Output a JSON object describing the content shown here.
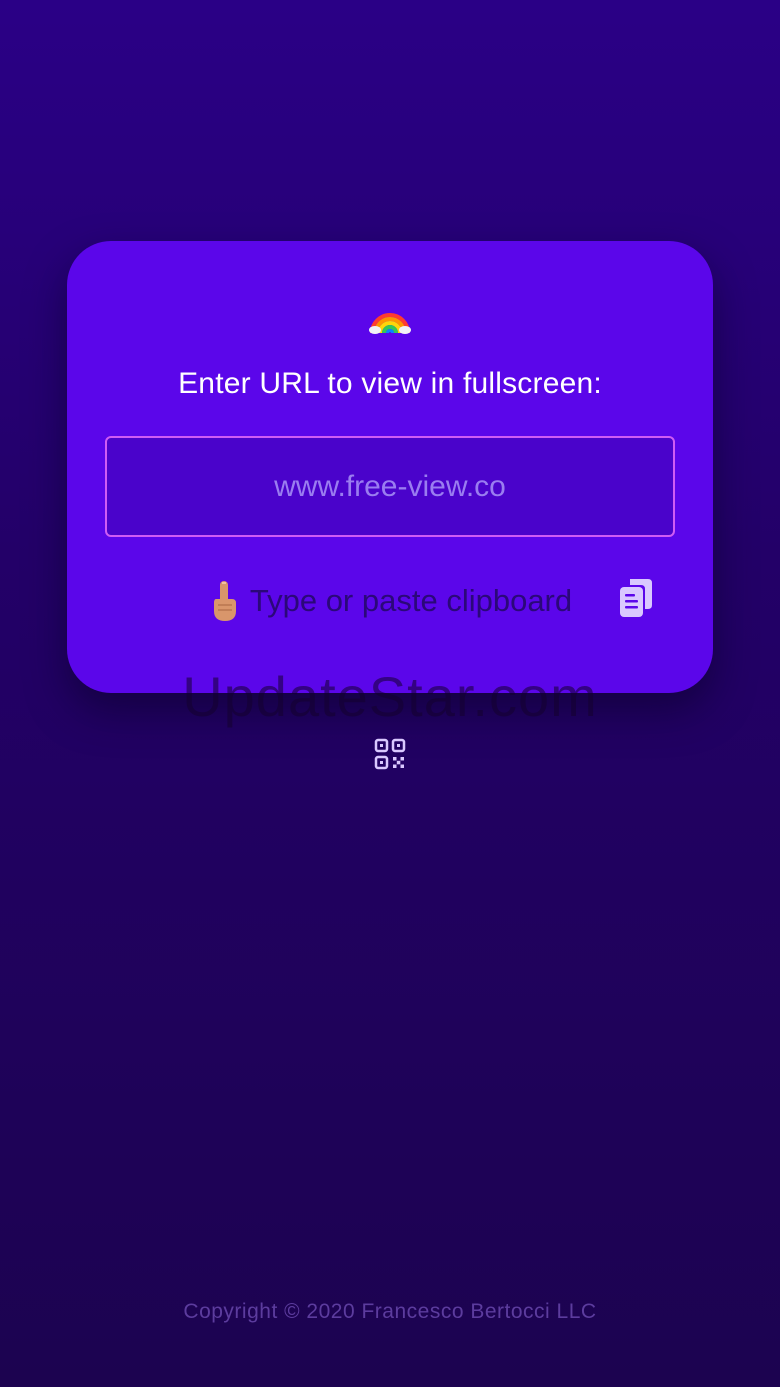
{
  "card": {
    "rainbow_icon": "rainbow-emoji",
    "title": "Enter URL to view in fullscreen:",
    "url_input": {
      "placeholder": "www.free-view.co",
      "value": ""
    },
    "paste_hint": {
      "hand_icon": "pointing-up-hand-emoji",
      "label": "Type or paste clipboard"
    },
    "paste_button_icon": "clipboard-copy-icon"
  },
  "watermark": "UpdateStar.com",
  "qr_button_icon": "qr-code-icon",
  "footer": {
    "copyright": "Copyright © 2020 Francesco Bertocci LLC"
  },
  "colors": {
    "background_top": "#2a0086",
    "background_bottom": "#1c0350",
    "card": "#5b06ea",
    "input_border": "#d05cf4",
    "input_fill": "#4a03cb",
    "placeholder": "#9a7df0",
    "paste_label": "#2b0879",
    "copyright": "#5c3c9e"
  }
}
